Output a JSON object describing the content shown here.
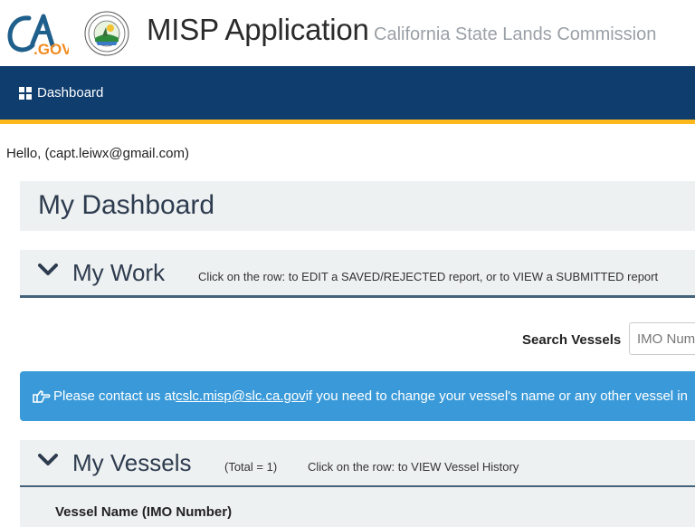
{
  "header": {
    "logo_text": "CA.GOV",
    "seal_text": "California State Lands Commission seal",
    "title": "MISP Application",
    "subtitle": "California State Lands Commission"
  },
  "nav": {
    "items": [
      {
        "label": "Dashboard",
        "icon": "grid-icon"
      }
    ]
  },
  "greeting": "Hello, (capt.leiwx@gmail.com)",
  "dashboard": {
    "title": "My Dashboard"
  },
  "my_work": {
    "title": "My Work",
    "hint": "Click on the row: to EDIT a SAVED/REJECTED report, or to VIEW a SUBMITTED report"
  },
  "search": {
    "label": "Search Vessels",
    "placeholder": "IMO Number"
  },
  "alert": {
    "icon": "hand-pointing-icon",
    "prefix": "Please contact us at ",
    "email": "cslc.misp@slc.ca.gov",
    "suffix": " if you need to change your vessel's name or any other vessel in"
  },
  "my_vessels": {
    "title": "My Vessels",
    "total": "(Total = 1)",
    "hint": "Click on the row: to VIEW Vessel History"
  },
  "vessels_table": {
    "columns": [
      "Vessel Name (IMO Number)"
    ]
  },
  "colors": {
    "nav_bg": "#0f3d6e",
    "nav_accent": "#fdb81e",
    "alert_bg": "#3a9ad9",
    "panel_bg": "#eef1f2"
  }
}
